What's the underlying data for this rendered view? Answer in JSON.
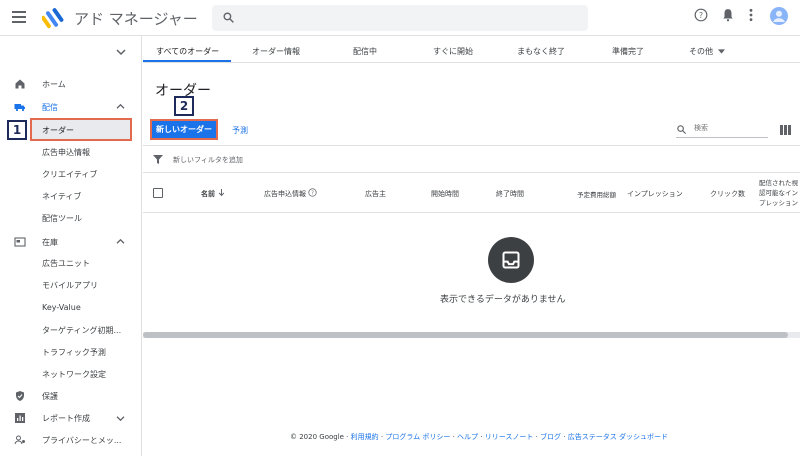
{
  "app": {
    "title": "アド マネージャー"
  },
  "sidebar": {
    "items": [
      {
        "label": "ホーム",
        "icon": "home-icon"
      },
      {
        "label": "配信",
        "icon": "delivery-truck-icon",
        "color": "#1a73e8"
      },
      {
        "label": "在庫",
        "icon": "inventory-icon"
      },
      {
        "label": "保護",
        "icon": "shield-icon"
      },
      {
        "label": "レポート作成",
        "icon": "bar-chart-icon"
      },
      {
        "label": "プライバシーとメッ...",
        "icon": "person-icon"
      }
    ],
    "delivery_sub": [
      "オーダー",
      "広告申込情報",
      "クリエイティブ",
      "ネイティブ",
      "配信ツール"
    ],
    "inventory_sub": [
      "広告ユニット",
      "モバイルアプリ",
      "Key-Value",
      "ターゲティング初期...",
      "トラフィック予測",
      "ネットワーク設定"
    ]
  },
  "annotations": {
    "badge1": "1",
    "badge2": "2"
  },
  "tabs": [
    "すべてのオーダー",
    "オーダー情報",
    "配信中",
    "すぐに開始",
    "まもなく終了",
    "準備完了",
    "その他"
  ],
  "main": {
    "title": "オーダー",
    "new_order_button": "新しいオーダー",
    "forecast_link": "予測",
    "search_placeholder": "検索",
    "filter_text": "新しいフィルタを追加",
    "columns": [
      "名前",
      "広告申込情報",
      "広告主",
      "開始時間",
      "終了時間",
      "予定費用総額",
      "インプレッション",
      "クリック数",
      "配信された視認可能なインプレッション"
    ],
    "empty_text": "表示できるデータがありません"
  },
  "footer": {
    "copyright": "© 2020 Google",
    "links": [
      "利用規約",
      "プログラム ポリシー",
      "ヘルプ",
      "リリースノート",
      "ブログ",
      "広告ステータス ダッシュボード"
    ]
  },
  "colors": {
    "accent": "#1a73e8",
    "highlight": "#e26a4f",
    "badge": "#1d2a5a"
  }
}
